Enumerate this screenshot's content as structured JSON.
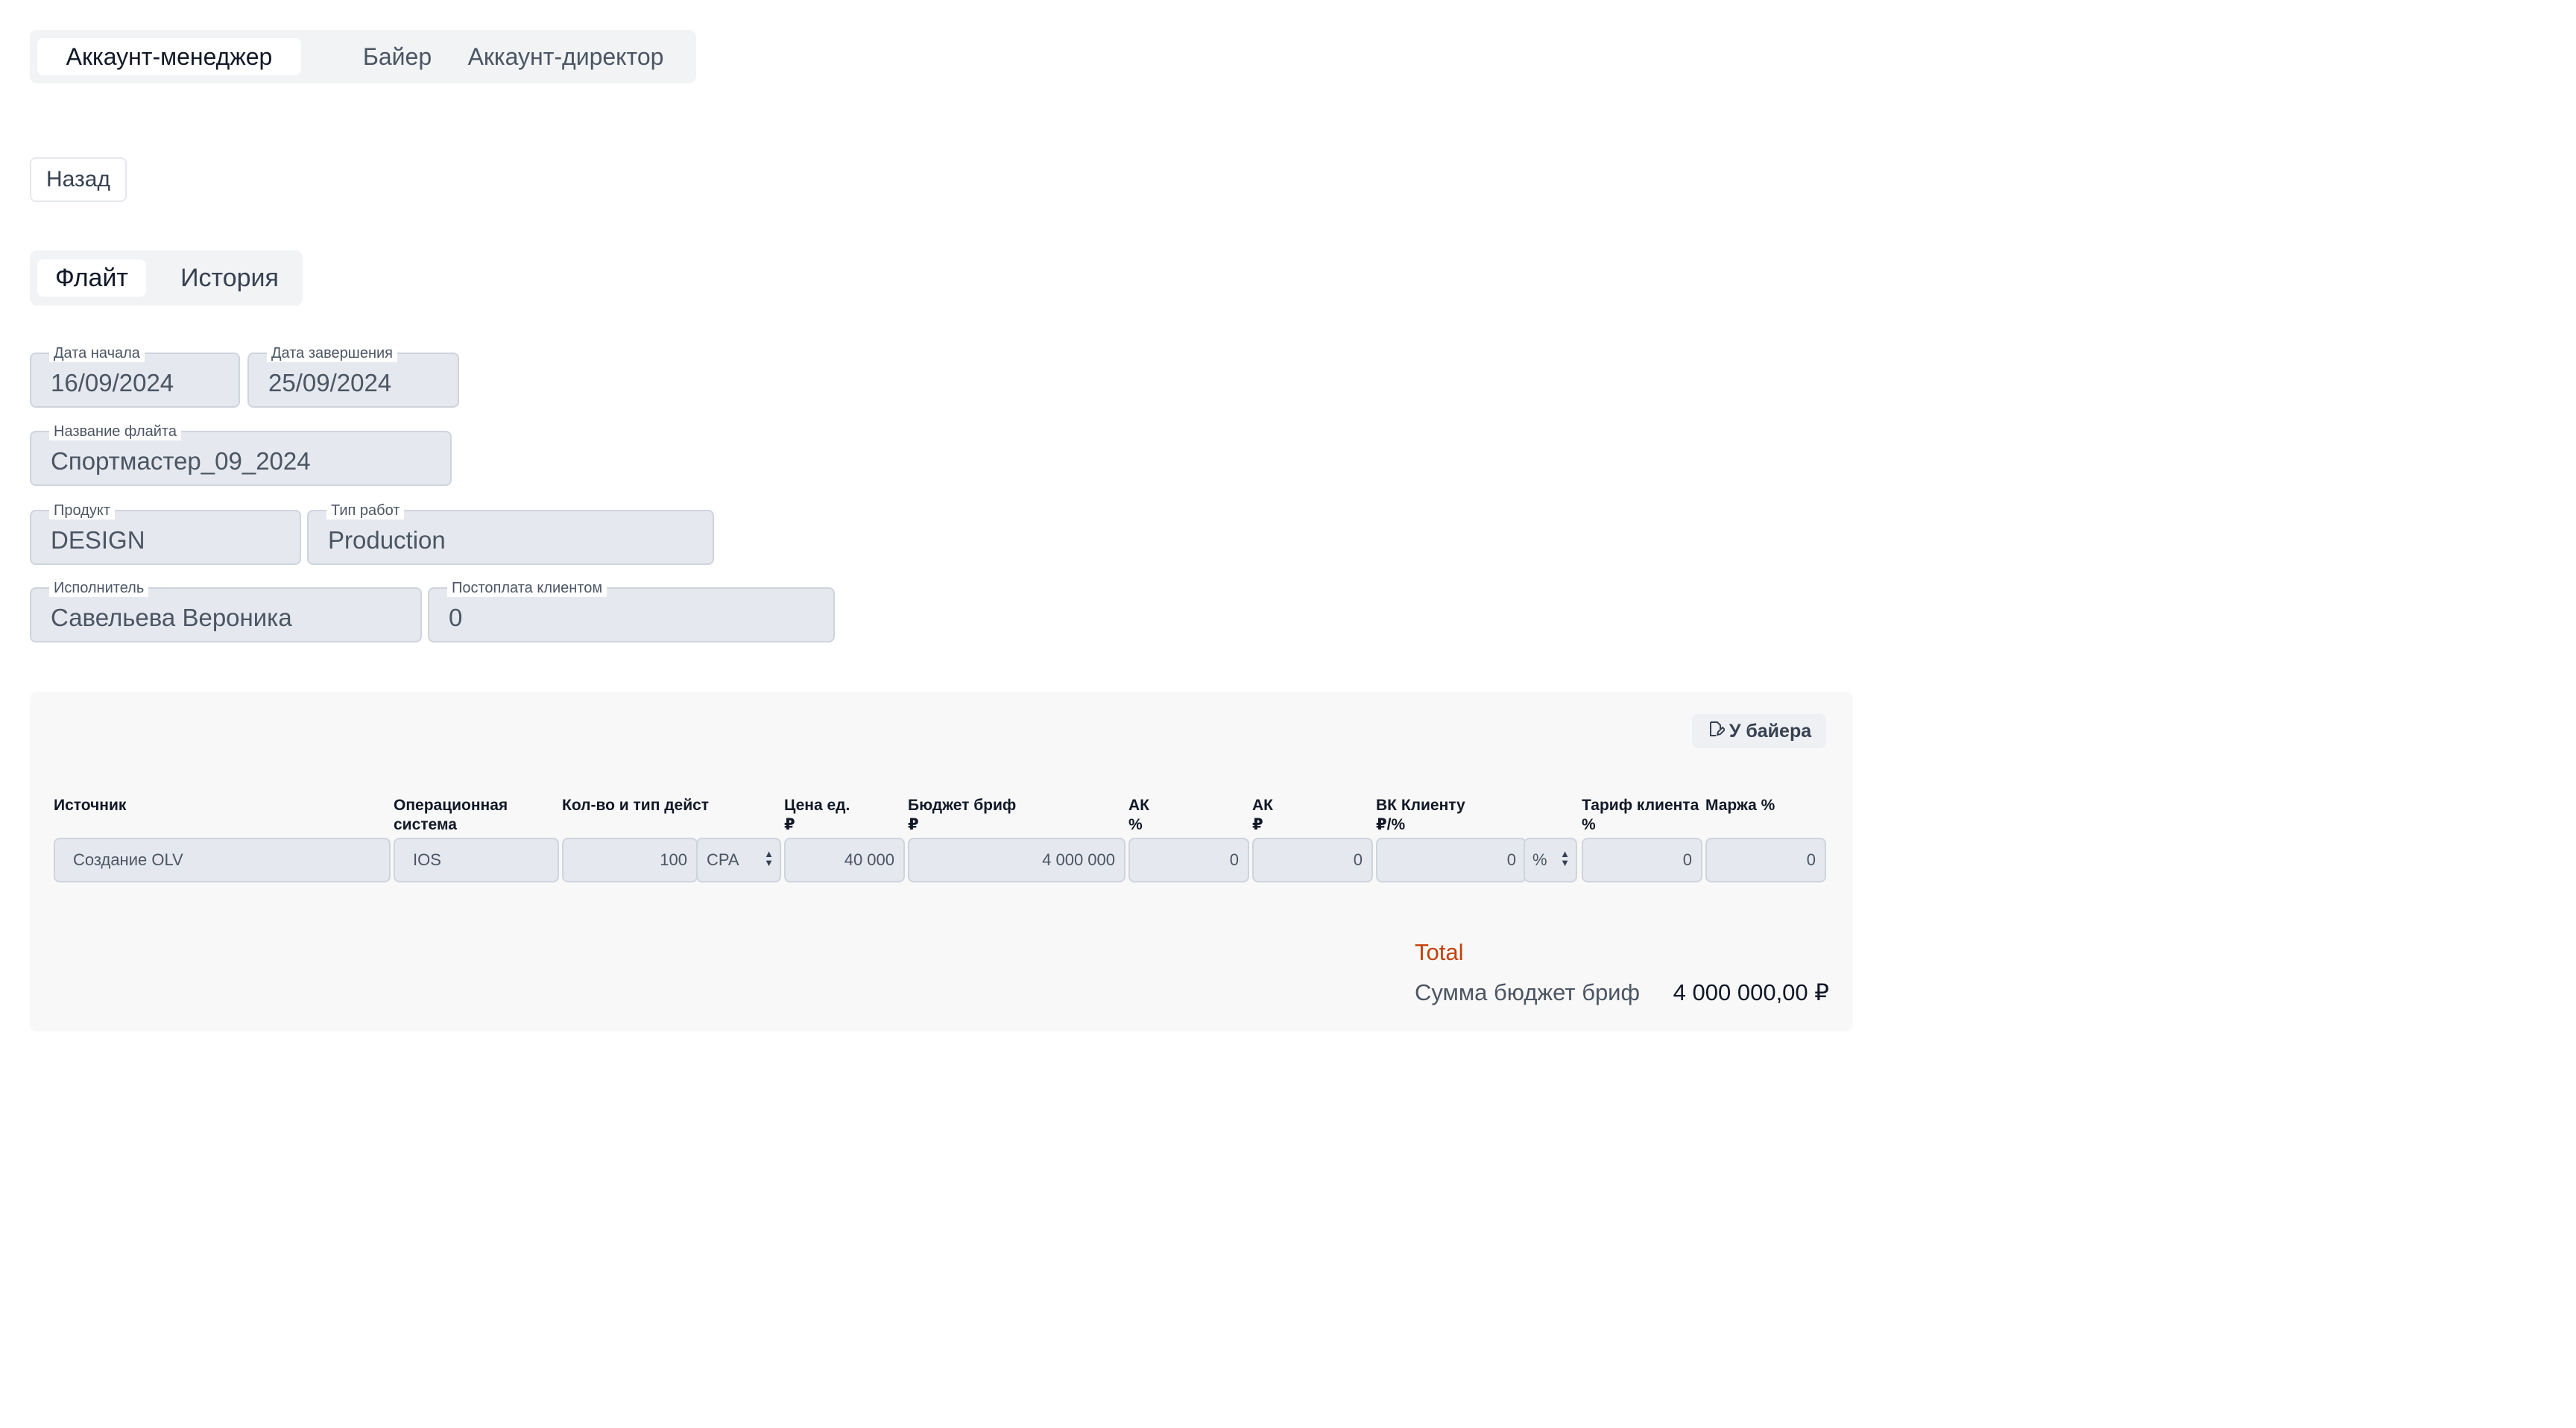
{
  "role_tabs": [
    "Аккаунт-менеджер",
    "Байер",
    "Аккаунт-директор"
  ],
  "back_label": "Назад",
  "page_tabs": [
    "Флайт",
    "История"
  ],
  "form": {
    "start_date": {
      "label": "Дата начала",
      "value": "16/09/2024"
    },
    "end_date": {
      "label": "Дата завершения",
      "value": "25/09/2024"
    },
    "flight_name": {
      "label": "Название флайта",
      "value": "Спортмастер_09_2024"
    },
    "product": {
      "label": "Продукт",
      "value": "DESIGN"
    },
    "work_type": {
      "label": "Тип работ",
      "value": "Production"
    },
    "executor": {
      "label": "Исполнитель",
      "value": "Савельева Вероника"
    },
    "postpayment": {
      "label": "Постоплата клиентом",
      "value": "0"
    }
  },
  "buyer_button": "У байера",
  "table": {
    "headers": {
      "source": "Источник",
      "os": "Операционная\nсистема",
      "qty": "Кол-во и тип дейст",
      "price": "Цена ед.\n₽",
      "budget": "Бюджет бриф\n₽",
      "ak_pct": "АК\n%",
      "ak_rub": "АК\n₽",
      "vk": "ВК Клиенту\n₽/%",
      "tariff": "Тариф клиента\n%",
      "margin": "Маржа %"
    },
    "row": {
      "source": "Создание OLV",
      "os": "IOS",
      "qty": "100",
      "action_type": "CPA",
      "price": "40 000",
      "budget": "4 000 000",
      "ak_pct": "0",
      "ak_rub": "0",
      "vk": "0",
      "vk_unit": "%",
      "tariff": "0",
      "margin": "0"
    }
  },
  "totals": {
    "title": "Total",
    "sum_label": "Сумма бюджет бриф",
    "sum_value": "4 000 000,00 ₽"
  },
  "colors": {
    "accent_total": "#c2410c",
    "field_bg": "#e5e8ee"
  }
}
